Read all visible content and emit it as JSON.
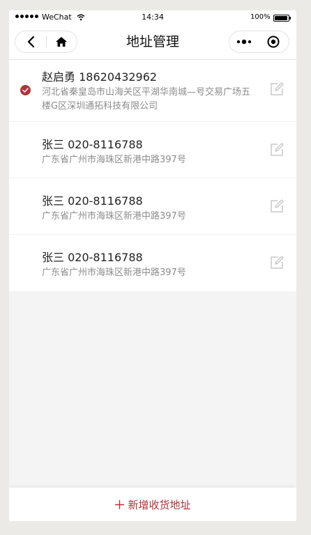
{
  "status_bar": {
    "carrier": "WeChat",
    "time": "14:34",
    "battery": "100%"
  },
  "nav": {
    "title": "地址管理",
    "back_icon": "chevron-left-icon",
    "home_icon": "home-icon",
    "more_icon": "more-icon",
    "close_icon": "target-icon"
  },
  "addresses": [
    {
      "name": "赵启勇",
      "phone": "18620432962",
      "address": "河北省秦皇岛市山海关区平湖华南城—号交易广场五楼G区深圳通拓科技有限公司",
      "selected": true
    },
    {
      "name": "张三",
      "phone": "020-8116788",
      "address": "广东省广州市海珠区新港中路397号",
      "selected": false
    },
    {
      "name": "张三",
      "phone": "020-8116788",
      "address": "广东省广州市海珠区新港中路397号",
      "selected": false
    },
    {
      "name": "张三",
      "phone": "020-8116788",
      "address": "广东省广州市海珠区新港中路397号",
      "selected": false
    }
  ],
  "bottom": {
    "add_label": "新增收货地址"
  },
  "colors": {
    "accent": "#b0343a",
    "background": "#f4f4f4",
    "muted_text": "#8c8c8c",
    "icon_gray": "#c8c8c8"
  }
}
